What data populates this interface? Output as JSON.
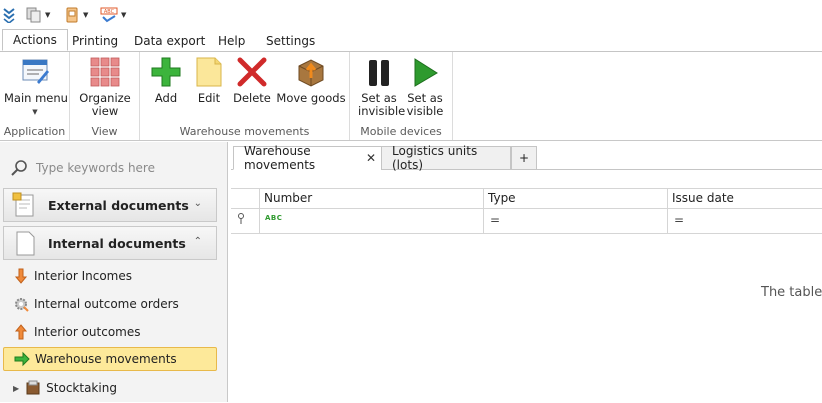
{
  "ribbon_tabs": [
    "Actions",
    "Printing",
    "Data export",
    "Help",
    "Settings"
  ],
  "ribbon": {
    "application": {
      "label": "Application",
      "main_menu": "Main menu"
    },
    "view": {
      "label": "View",
      "organize_view_1": "Organize",
      "organize_view_2": "view"
    },
    "warehouse_movements": {
      "label": "Warehouse movements",
      "add": "Add",
      "edit": "Edit",
      "delete": "Delete",
      "move_goods": "Move goods"
    },
    "mobile_devices": {
      "label": "Mobile devices",
      "invisible_1": "Set as",
      "invisible_2": "invisible",
      "visible_1": "Set as",
      "visible_2": "visible"
    }
  },
  "nav": {
    "search_placeholder": "Type keywords here",
    "external_documents": "External documents",
    "internal_documents": "Internal documents",
    "items": [
      "Interior Incomes",
      "Internal outcome orders",
      "Interior outcomes",
      "Warehouse movements",
      "Stocktaking"
    ]
  },
  "doc_tabs": {
    "tab1": "Warehouse movements",
    "tab2": "Logistics units (lots)",
    "close": "✕",
    "add": "+"
  },
  "grid": {
    "columns": [
      "Number",
      "Type",
      "Issue date"
    ],
    "filter_abc": "ABC",
    "filter_eq": "=",
    "empty_text": "The table"
  },
  "colors": {
    "selected_bg": "#fde99a",
    "accent_green": "#2e9a2e",
    "delete_red": "#d02a2a"
  }
}
